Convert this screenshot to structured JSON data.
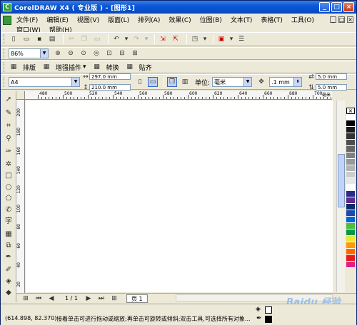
{
  "window": {
    "title": "CorelDRAW X4 ( 专业版 ) - [图形1]",
    "min": "_",
    "max": "□",
    "close": "×"
  },
  "menu": {
    "items": [
      "文件(F)",
      "编辑(E)",
      "视图(V)",
      "版面(L)",
      "排列(A)",
      "效果(C)",
      "位图(B)",
      "文本(T)",
      "表格(T)",
      "工具(O)",
      "窗口(W)",
      "帮助(H)"
    ]
  },
  "zoom": {
    "value": "86%"
  },
  "addons": {
    "items": [
      "排版",
      "增强插件",
      "转换",
      "贴齐"
    ]
  },
  "property": {
    "page_size": "A4",
    "width": "297.0 mm",
    "height": "210.0 mm",
    "unit_label": "单位:",
    "unit": "毫米",
    "nudge": ".1 mm",
    "dup_x": "5.0 mm",
    "dup_y": "5.0 mm"
  },
  "ruler": {
    "h_ticks": [
      "480",
      "500",
      "520",
      "540",
      "560",
      "580",
      "600",
      "620",
      "640",
      "660",
      "680",
      "700"
    ],
    "h_unit": "毫米",
    "v_ticks": [
      "200",
      "180",
      "160",
      "140",
      "120",
      "100",
      "80",
      "60",
      "40",
      "20"
    ]
  },
  "page_nav": {
    "counter": "1 / 1",
    "tab": "页 1"
  },
  "status": {
    "coords": "(614.898, 82.370)",
    "hint": "接着单击可进行拖动或缩放;再单击可旋转或倾斜;双击工具,可选择所有对象..."
  },
  "palette": {
    "colors": [
      "#ffffff",
      "#000000",
      "#1a1a1a",
      "#333333",
      "#4d4d4d",
      "#666666",
      "#808080",
      "#999999",
      "#b3b3b3",
      "#cccccc",
      "#e6e6e6",
      "#ffffff",
      "#2a2a8a",
      "#5b2a8a",
      "#0a2a6a",
      "#1a4ab0",
      "#0066cc",
      "#4dbd3a",
      "#009a4a",
      "#e8e83a",
      "#ff9900",
      "#ff6600",
      "#e81a1a",
      "#e81a8a"
    ]
  },
  "watermark": "Baidu 经验"
}
